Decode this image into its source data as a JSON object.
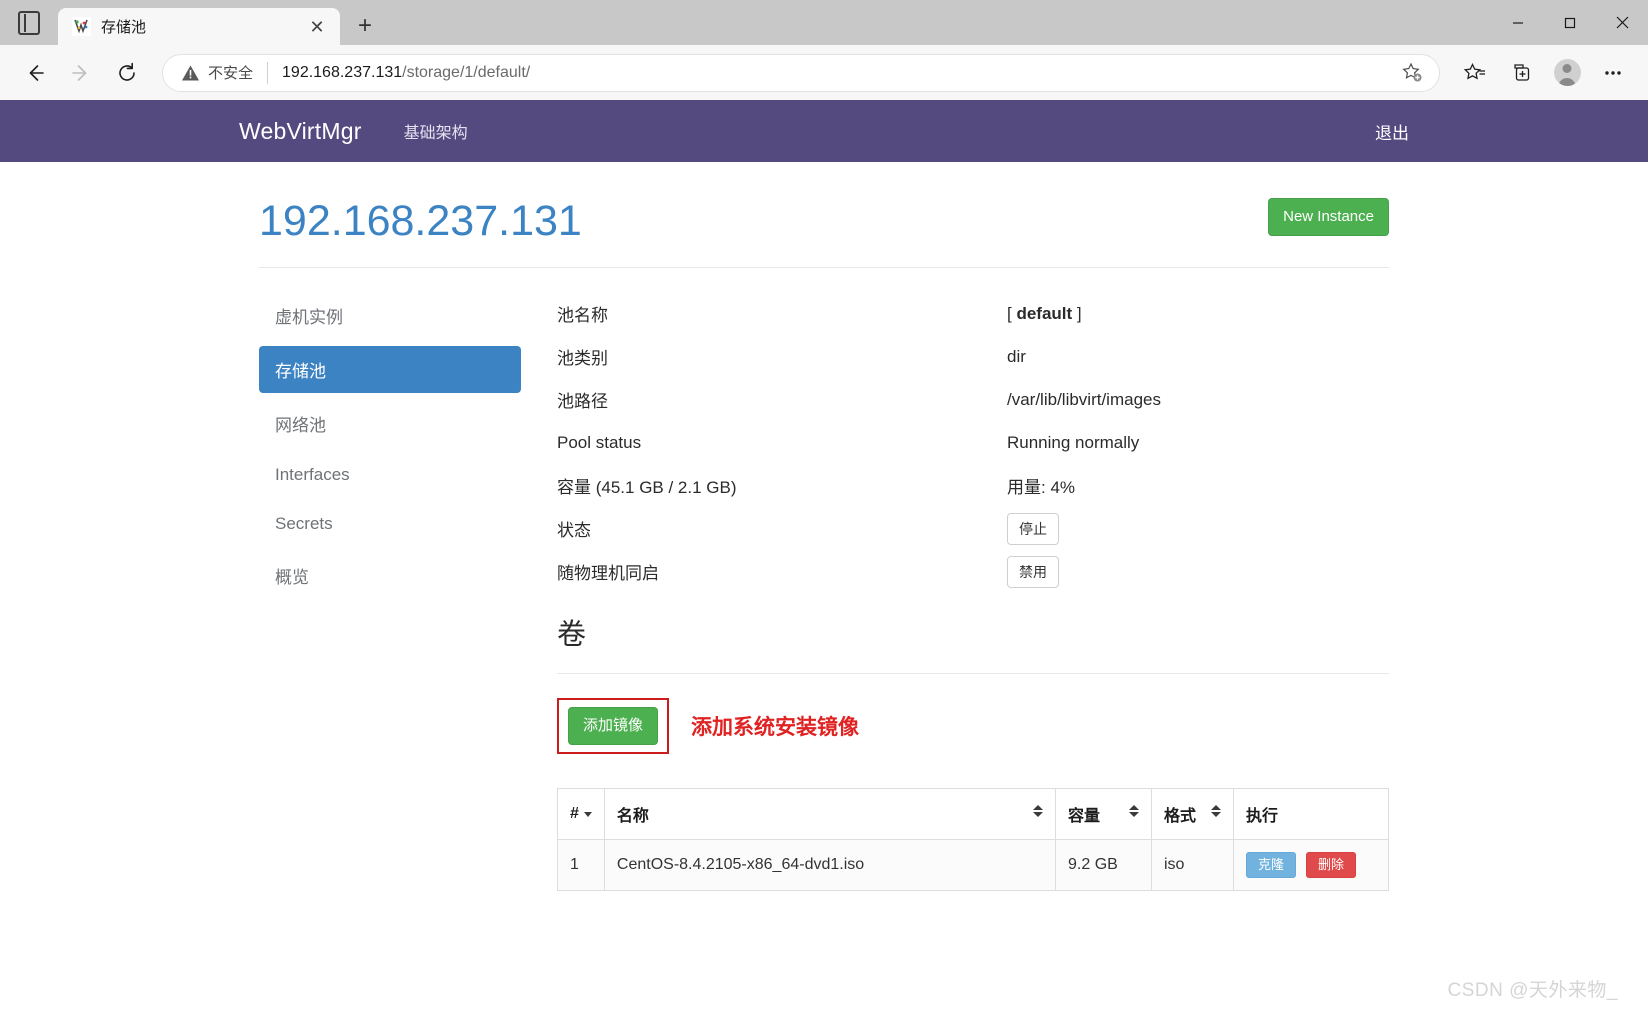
{
  "browser": {
    "tab": {
      "title": "存储池",
      "close_label": "✕",
      "favicon": "webvirtmgr-favicon"
    },
    "new_tab_label": "+",
    "window": {
      "minimize": "–",
      "maximize": "□",
      "close": "✕"
    },
    "toolbar": {
      "back": "←",
      "forward": "→",
      "reload": "⟳",
      "security_label": "不安全",
      "url_domain": "192.168.237.131",
      "url_path": "/storage/1/default/",
      "url_full": "192.168.237.131/storage/1/default/",
      "add_favorite": "☆",
      "favorites": "favorites",
      "collections": "collections",
      "profile": "profile",
      "settings_more": "⋯"
    }
  },
  "navbar": {
    "brand": "WebVirtMgr",
    "links": [
      {
        "label": "基础架构"
      }
    ],
    "logout": "退出"
  },
  "page": {
    "title": "192.168.237.131",
    "new_instance_label": "New Instance"
  },
  "sidebar": {
    "items": [
      {
        "label": "虚机实例",
        "active": false
      },
      {
        "label": "存储池",
        "active": true
      },
      {
        "label": "网络池",
        "active": false
      },
      {
        "label": "Interfaces",
        "active": false
      },
      {
        "label": "Secrets",
        "active": false
      },
      {
        "label": "概览",
        "active": false
      }
    ]
  },
  "details": {
    "rows": [
      {
        "label": "池名称",
        "value": "[ default ]",
        "bold": true
      },
      {
        "label": "池类别",
        "value": "dir"
      },
      {
        "label": "池路径",
        "value": "/var/lib/libvirt/images"
      },
      {
        "label": "Pool status",
        "value": "Running normally"
      },
      {
        "label": "容量 (45.1 GB / 2.1 GB)",
        "value": "用量: 4%"
      },
      {
        "label": "状态",
        "value": "停止",
        "is_button": true
      },
      {
        "label": "随物理机同启",
        "value": "禁用",
        "is_button": true
      }
    ],
    "pool_name": "[ default ]",
    "pool_name_inner": "default",
    "pool_type": "dir",
    "pool_path": "/var/lib/libvirt/images",
    "pool_status_label": "Pool status",
    "pool_status_value": "Running normally",
    "capacity_label": "容量 (45.1 GB / 2.1 GB)",
    "usage_value": "用量: 4%",
    "state_label": "状态",
    "state_button": "停止",
    "autostart_label": "随物理机同启",
    "autostart_button": "禁用"
  },
  "volumes": {
    "section_title": "卷",
    "add_image_button": "添加镜像",
    "annotation": "添加系统安装镜像",
    "columns": [
      {
        "key": "idx",
        "label": "#",
        "sort": "single"
      },
      {
        "key": "name",
        "label": "名称",
        "sort": "both"
      },
      {
        "key": "capacity",
        "label": "容量",
        "sort": "both"
      },
      {
        "key": "format",
        "label": "格式",
        "sort": "both"
      },
      {
        "key": "actions",
        "label": "执行",
        "sort": "none"
      }
    ],
    "rows": [
      {
        "idx": "1",
        "name": "CentOS-8.4.2105-x86_64-dvd1.iso",
        "capacity": "9.2 GB",
        "format": "iso",
        "clone_label": "克隆",
        "delete_label": "删除"
      }
    ]
  },
  "watermark": "CSDN @天外来物_",
  "colors": {
    "navbar_purple": "#554a80",
    "title_blue": "#3c83c4",
    "pill_active_blue": "#3c83c4",
    "success_green": "#4cb050",
    "info_blue": "#72b2de",
    "danger_red": "#e04a4a",
    "annotation_red": "#e02222",
    "annotation_box_red": "#cc1c1c"
  }
}
